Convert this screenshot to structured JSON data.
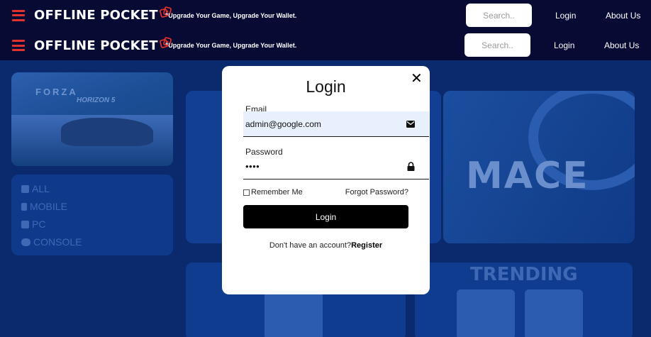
{
  "header": {
    "logo_text": "OFFLINE POCKET",
    "tagline": "\"Upgrade Your Game, Upgrade Your Wallet.",
    "search_placeholder": "Search..",
    "login_link": "Login",
    "about_link": "About Us"
  },
  "background": {
    "forza_title": "FORZA",
    "forza_subtitle": "HORIZON 5",
    "categories": [
      "ALL",
      "MOBILE",
      "PC",
      "CONSOLE"
    ],
    "featured_title": "MACE",
    "trending_label": "TRENDING"
  },
  "login_modal": {
    "title": "Login",
    "close_label": "✕",
    "email_label": "Email",
    "email_value": "admin@google.com",
    "password_label": "Password",
    "password_value": "••••",
    "remember_label": "Remember Me",
    "forgot_label": "Forgot Password?",
    "submit_label": "Login",
    "signup_prompt": "Don't have an account?",
    "signup_link": "Register"
  },
  "colors": {
    "header_bg": "#070a33",
    "page_bg": "#0b2a6e",
    "accent_red": "#e1322d",
    "modal_bg": "#ffffff",
    "button_bg": "#000000",
    "autofill_bg": "#e8f0fe"
  },
  "icons": {
    "menu": "hamburger-menu-icon",
    "logo": "dice-icon",
    "email": "envelope-icon",
    "password": "lock-icon"
  }
}
